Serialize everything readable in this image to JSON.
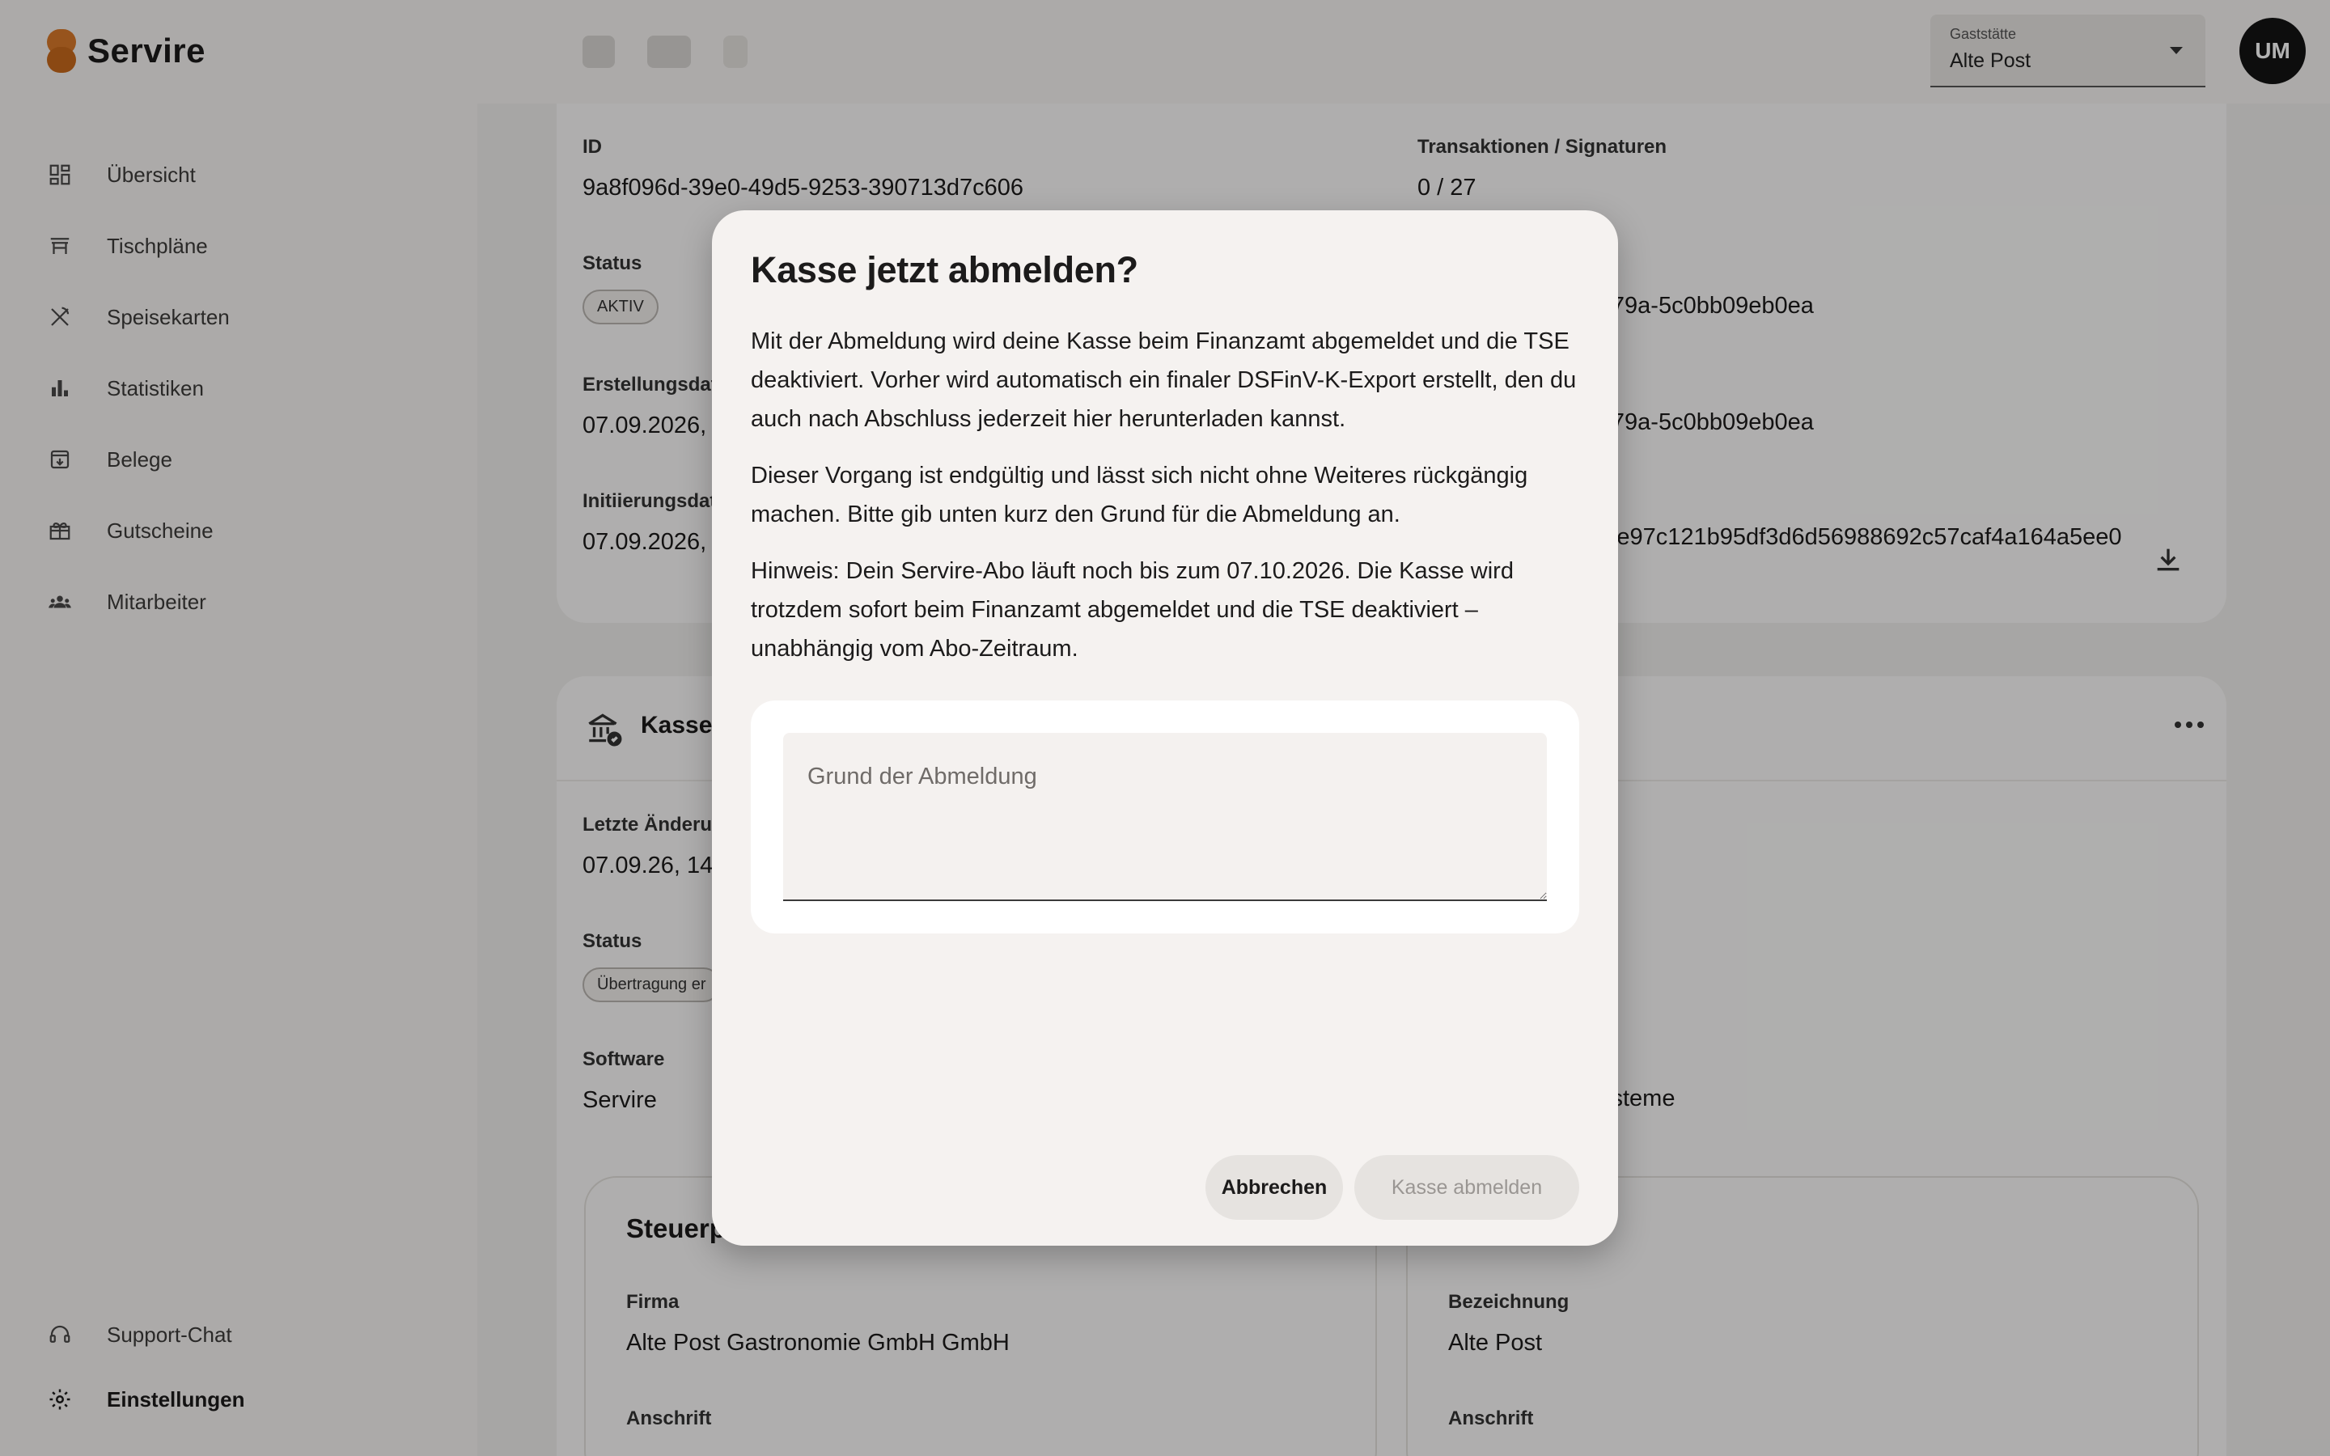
{
  "brand": {
    "name": "Servire"
  },
  "sidebar": {
    "items": [
      {
        "label": "Übersicht",
        "icon": "dashboard-icon"
      },
      {
        "label": "Tischpläne",
        "icon": "table-icon"
      },
      {
        "label": "Speisekarten",
        "icon": "cutlery-icon"
      },
      {
        "label": "Statistiken",
        "icon": "bar-chart-icon"
      },
      {
        "label": "Belege",
        "icon": "receipt-icon"
      },
      {
        "label": "Gutscheine",
        "icon": "gift-icon"
      },
      {
        "label": "Mitarbeiter",
        "icon": "people-icon"
      }
    ],
    "bottom": [
      {
        "label": "Support-Chat",
        "icon": "headset-icon"
      },
      {
        "label": "Einstellungen",
        "icon": "gear-icon"
      }
    ]
  },
  "header": {
    "venue_label": "Gaststätte",
    "venue_value": "Alte Post",
    "avatar_initials": "UM"
  },
  "tse": {
    "id_label": "ID",
    "id_value": "9a8f096d-39e0-49d5-9253-390713d7c606",
    "tx_label": "Transaktionen / Signaturen",
    "tx_value": "0 / 27",
    "status_label": "Status",
    "status_value": "AKTIV",
    "right_value_1": "a-979a-5c0bb09eb0ea",
    "created_label": "Erstellungsdat",
    "created_value": "07.09.2026, 14",
    "right_value_2": "a-979a-5c0bb09eb0ea",
    "init_label": "Initiierungsdat",
    "init_value": "07.09.2026, 1",
    "right_label_3": "er",
    "right_value_3": "504e97c121b95df3d6d56988692c57caf4a164a5ee0"
  },
  "kasse": {
    "title": "Kassen",
    "changed_label": "Letzte Änderun",
    "changed_value": "07.09.26, 14:1",
    "status_label": "Status",
    "status_value": "Übertragung er",
    "software_label": "Software",
    "software_value": "Servire",
    "right_software_value": "-Systeme",
    "left_sub_title": "Steuerp",
    "firma_label": "Firma",
    "firma_value": "Alte Post Gastronomie GmbH GmbH",
    "left_address_label": "Anschrift",
    "bez_label": "Bezeichnung",
    "bez_value": "Alte Post",
    "right_address_label": "Anschrift"
  },
  "dialog": {
    "title": "Kasse jetzt abmelden?",
    "paragraph_1": "Mit der Abmeldung wird deine Kasse beim Finanzamt abgemeldet und die TSE deaktiviert. Vorher wird automatisch ein finaler DSFinV-K-Export erstellt, den du auch nach Abschluss jederzeit hier herunterladen kannst.",
    "paragraph_2": "Dieser Vorgang ist endgültig und lässt sich nicht ohne Weiteres rückgängig machen. Bitte gib unten kurz den Grund für die Abmeldung an.",
    "paragraph_3": "Hinweis: Dein Servire-Abo läuft noch bis zum 07.10.2026. Die Kasse wird trotzdem sofort beim Finanzamt abgemeldet und die TSE deaktiviert – unabhängig vom Abo-Zeitraum.",
    "reason_placeholder": "Grund der Abmeldung",
    "reason_value": "",
    "cancel_label": "Abbrechen",
    "submit_label": "Kasse abmelden"
  },
  "colors": {
    "brand_orange": "#d9792a",
    "scrim": "rgba(0,0,0,0.3)",
    "dialog_bg": "#f5f2f0"
  }
}
